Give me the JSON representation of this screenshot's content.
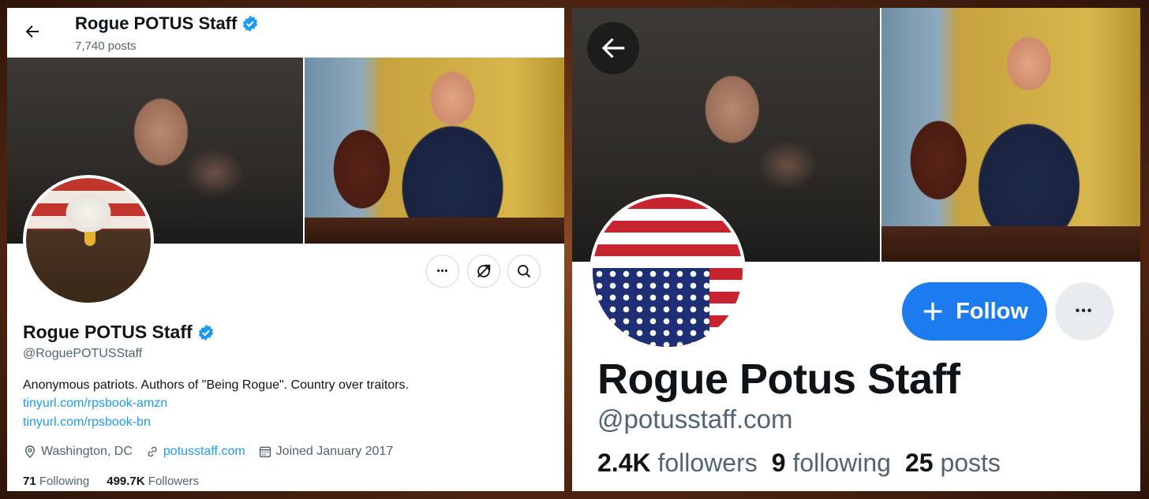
{
  "left": {
    "header": {
      "name": "Rogue POTUS Staff",
      "posts": "7,740 posts"
    },
    "profile": {
      "name": "Rogue POTUS Staff",
      "handle": "@RoguePOTUSStaff",
      "bio": "Anonymous patriots. Authors of \"Being Rogue\". Country over traitors.",
      "links": [
        "tinyurl.com/rpsbook-amzn",
        "tinyurl.com/rpsbook-bn"
      ],
      "location": "Washington, DC",
      "website": "potusstaff.com",
      "joined": "Joined January 2017"
    },
    "stats": {
      "following_count": "71",
      "following_label": "Following",
      "followers_count": "499.7K",
      "followers_label": "Followers"
    },
    "buttons": {
      "more": "•••"
    },
    "icons": [
      "back-arrow-icon",
      "verified-badge-icon",
      "more-icon",
      "subscribe-icon",
      "search-icon",
      "location-icon",
      "link-icon",
      "calendar-icon"
    ],
    "colors": {
      "link": "#1d9bf0",
      "verified": "#1d9bf0"
    }
  },
  "right": {
    "profile": {
      "name": "Rogue Potus Staff",
      "handle": "@potusstaff.com"
    },
    "buttons": {
      "follow": "Follow",
      "more": "•••"
    },
    "stats": {
      "followers_count": "2.4K",
      "followers_label": "followers",
      "following_count": "9",
      "following_label": "following",
      "posts_count": "25",
      "posts_label": "posts"
    },
    "icons": [
      "back-arrow-icon",
      "plus-icon",
      "more-icon"
    ],
    "colors": {
      "follow_button": "#1d7bf0"
    }
  }
}
